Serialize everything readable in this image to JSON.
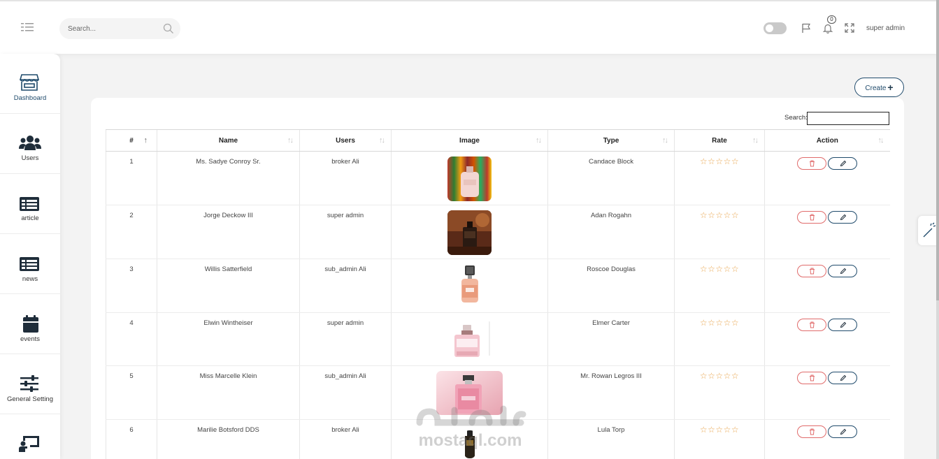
{
  "header": {
    "search_placeholder": "Search...",
    "notification_count": "0",
    "user_name": "super admin"
  },
  "sidebar": {
    "items": [
      {
        "label": "Dashboard",
        "icon": "store-icon"
      },
      {
        "label": "Users",
        "icon": "users-icon"
      },
      {
        "label": "article",
        "icon": "list-icon"
      },
      {
        "label": "news",
        "icon": "list-icon"
      },
      {
        "label": "events",
        "icon": "calendar-icon"
      },
      {
        "label": "General Setting",
        "icon": "sliders-icon"
      },
      {
        "label": "",
        "icon": "presentation-icon"
      }
    ]
  },
  "main": {
    "create_label": "Create",
    "table_search_label": "Search:",
    "columns": [
      "#",
      "Name",
      "Users",
      "Image",
      "Type",
      "Rate",
      "Action"
    ],
    "rows": [
      {
        "num": "1",
        "name": "Ms. Sadye Conroy Sr.",
        "user": "broker Ali",
        "type": "Candace Block",
        "rating": 0
      },
      {
        "num": "2",
        "name": "Jorge Deckow III",
        "user": "super admin",
        "type": "Adan Rogahn",
        "rating": 0
      },
      {
        "num": "3",
        "name": "Willis Satterfield",
        "user": "sub_admin Ali",
        "type": "Roscoe Douglas",
        "rating": 0
      },
      {
        "num": "4",
        "name": "Elwin Wintheiser",
        "user": "super admin",
        "type": "Elmer Carter",
        "rating": 0
      },
      {
        "num": "5",
        "name": "Miss Marcelle Klein",
        "user": "sub_admin Ali",
        "type": "Mr. Rowan Legros III",
        "rating": 0
      },
      {
        "num": "6",
        "name": "Marilie Botsford DDS",
        "user": "broker Ali",
        "type": "Lula Torp",
        "rating": 0
      }
    ]
  },
  "watermark": {
    "arabic": "مستقل",
    "latin": "mostaql.com"
  },
  "colors": {
    "accent": "#1f4a6b",
    "danger": "#e06b6b",
    "star": "#e8a34a"
  }
}
